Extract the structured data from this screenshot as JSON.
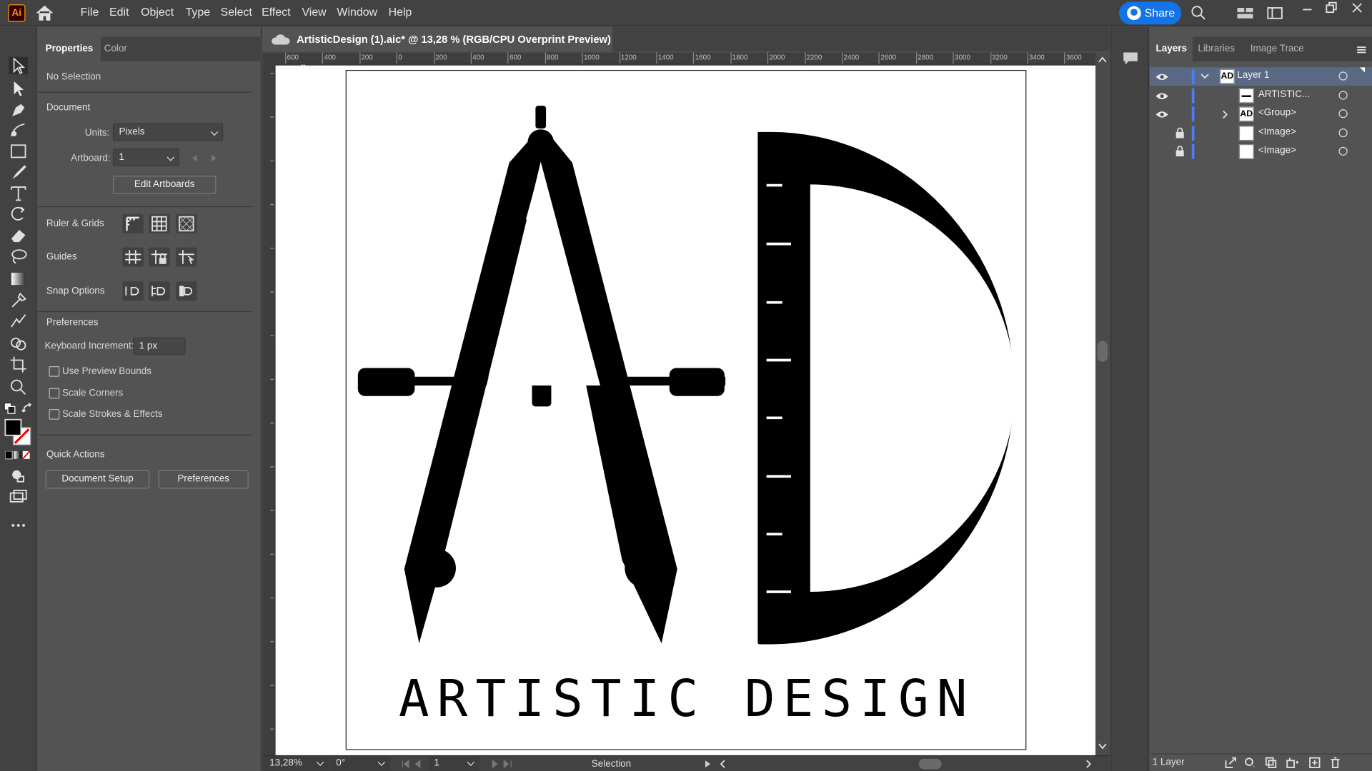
{
  "app": {
    "logo_text": "Ai",
    "menu": [
      "File",
      "Edit",
      "Object",
      "Type",
      "Select",
      "Effect",
      "View",
      "Window",
      "Help"
    ],
    "share_label": "Share"
  },
  "properties_panel": {
    "tabs": [
      "Properties",
      "Color"
    ],
    "selection_status": "No Selection",
    "document_heading": "Document",
    "units_label": "Units:",
    "units_value": "Pixels",
    "artboard_label": "Artboard:",
    "artboard_value": "1",
    "edit_artboards_label": "Edit Artboards",
    "ruler_grids_label": "Ruler & Grids",
    "guides_label": "Guides",
    "snap_options_label": "Snap Options",
    "preferences_heading": "Preferences",
    "keyboard_increment_label": "Keyboard Increment:",
    "keyboard_increment_value": "1 px",
    "checkboxes": [
      "Use Preview Bounds",
      "Scale Corners",
      "Scale Strokes & Effects"
    ],
    "quick_actions_heading": "Quick Actions",
    "document_setup_label": "Document Setup",
    "preferences_button_label": "Preferences"
  },
  "document": {
    "tab_title": "ArtisticDesign (1).aic* @ 13,28 % (RGB/CPU Overprint Preview)",
    "close_glyph": "×",
    "ruler_top_labels": [
      "600",
      "400",
      "200",
      "0",
      "200",
      "400",
      "600",
      "800",
      "1000",
      "1200",
      "1400",
      "1600",
      "1800",
      "2000",
      "2200",
      "2400",
      "2600",
      "2800",
      "3000",
      "3200",
      "3400",
      "3600"
    ],
    "logo_text": "ARTISTIC DESIGN"
  },
  "status_bar": {
    "zoom": "13,28%",
    "rotation": "0°",
    "artboard_nav": "1",
    "tool": "Selection"
  },
  "layers_panel": {
    "tabs": [
      "Layers",
      "Libraries",
      "Image Trace"
    ],
    "rows": [
      {
        "name": "Layer 1",
        "visible": true,
        "locked": false
      },
      {
        "name": "ARTISTIC...",
        "visible": true,
        "locked": false
      },
      {
        "name": "<Group>",
        "visible": true,
        "locked": false
      },
      {
        "name": "<Image>",
        "visible": false,
        "locked": true
      },
      {
        "name": "<Image>",
        "visible": false,
        "locked": true
      }
    ],
    "footer_count": "1 Layer"
  },
  "colors": {
    "accent": "#1473e6",
    "layer_color": "#4f7cff",
    "ai_brand": "#ff9a00"
  }
}
